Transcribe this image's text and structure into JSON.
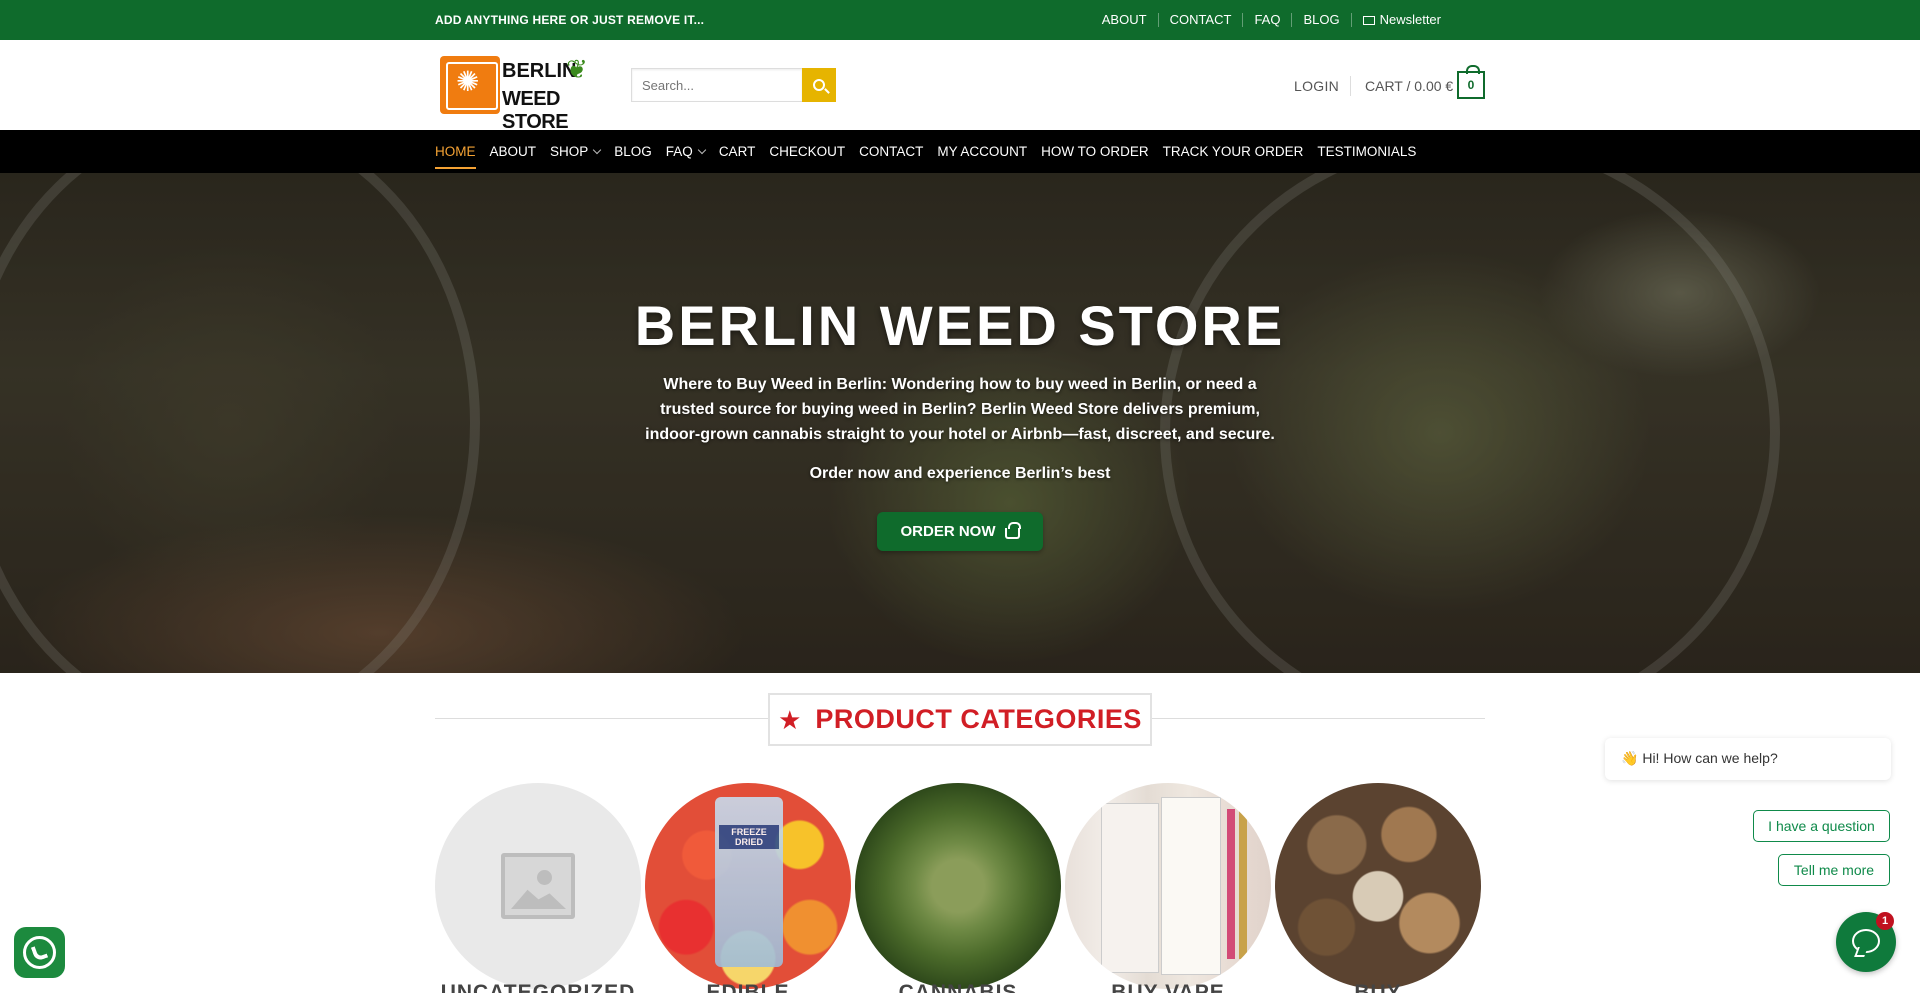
{
  "topbar": {
    "promo": "ADD ANYTHING HERE OR JUST REMOVE IT...",
    "links": [
      "ABOUT",
      "CONTACT",
      "FAQ",
      "BLOG"
    ],
    "newsletter": "Newsletter"
  },
  "header": {
    "logo_line1": "BERLIN",
    "logo_line2": "WEED STORE",
    "search_placeholder": "Search...",
    "login": "LOGIN",
    "cart_label": "CART / 0.00 €",
    "cart_count": "0"
  },
  "nav": {
    "items": [
      {
        "label": "HOME",
        "active": true
      },
      {
        "label": "ABOUT"
      },
      {
        "label": "SHOP",
        "dropdown": true
      },
      {
        "label": "BLOG"
      },
      {
        "label": "FAQ",
        "dropdown": true
      },
      {
        "label": "CART"
      },
      {
        "label": "CHECKOUT"
      },
      {
        "label": "CONTACT"
      },
      {
        "label": "MY ACCOUNT"
      },
      {
        "label": "HOW TO ORDER"
      },
      {
        "label": "TRACK YOUR ORDER"
      },
      {
        "label": "TESTIMONIALS"
      }
    ]
  },
  "hero": {
    "title": "BERLIN WEED STORE",
    "text": "Where to Buy Weed in Berlin: Wondering how to buy weed in Berlin, or need a trusted source for buying weed in Berlin? Berlin Weed Store delivers premium, indoor-grown cannabis straight to your hotel or Airbnb—fast, discreet, and secure.",
    "subtext": "Order now and experience Berlin’s best",
    "button": "ORDER NOW"
  },
  "categories": {
    "heading": "PRODUCT CATEGORIES",
    "items": [
      {
        "label": "UNCATEGORIZED"
      },
      {
        "label": "EDIBLE",
        "pack_text": "FREEZE DRIED"
      },
      {
        "label": "CANNABIS"
      },
      {
        "label": "BUY VAPE"
      },
      {
        "label": "BUY"
      }
    ]
  },
  "chat": {
    "greeting_emoji": "👋",
    "greeting": "Hi! How can we help?",
    "option1": "I have a question",
    "option2": "Tell me more",
    "badge": "1"
  },
  "colors": {
    "brand_green": "#0f6b2c",
    "accent_orange": "#f4a234",
    "heading_red": "#d11e25",
    "search_yellow": "#e6b400"
  }
}
